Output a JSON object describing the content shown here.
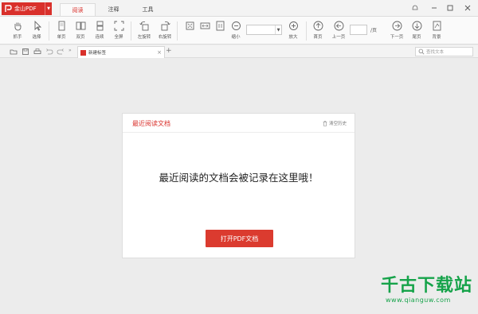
{
  "app": {
    "name": "金山PDF",
    "brand_color": "#d9302b"
  },
  "menu_tabs": [
    {
      "label": "阅读",
      "active": true
    },
    {
      "label": "注释",
      "active": false
    },
    {
      "label": "工具",
      "active": false
    }
  ],
  "ribbon": {
    "tools": [
      {
        "label": "抓手",
        "icon": "hand-icon"
      },
      {
        "label": "选择",
        "icon": "cursor-icon"
      },
      {
        "label": "单页",
        "icon": "single-page-icon"
      },
      {
        "label": "双页",
        "icon": "double-page-icon"
      },
      {
        "label": "连续",
        "icon": "continuous-icon"
      },
      {
        "label": "全屏",
        "icon": "fullscreen-icon"
      },
      {
        "label": "左旋转",
        "icon": "rotate-left-icon"
      },
      {
        "label": "右旋转",
        "icon": "rotate-right-icon"
      },
      {
        "label": "缩小",
        "icon": "zoom-out-icon"
      },
      {
        "label": "放大",
        "icon": "zoom-in-icon"
      },
      {
        "label": "首页",
        "icon": "first-page-icon"
      },
      {
        "label": "上一页",
        "icon": "prev-page-icon"
      },
      {
        "label": "下一页",
        "icon": "next-page-icon"
      },
      {
        "label": "尾页",
        "icon": "last-page-icon"
      },
      {
        "label": "背景",
        "icon": "background-icon"
      }
    ],
    "page_total": "/页"
  },
  "doc_tab": {
    "title": "新建标签"
  },
  "search": {
    "placeholder": "查找文本"
  },
  "card": {
    "title": "最近阅读文档",
    "clear_label": "清空历史",
    "message": "最近阅读的文档会被记录在这里哦！",
    "open_button": "打开PDF文档"
  },
  "watermark": {
    "title": "千古下载站",
    "url": "www.qianguw.com"
  }
}
